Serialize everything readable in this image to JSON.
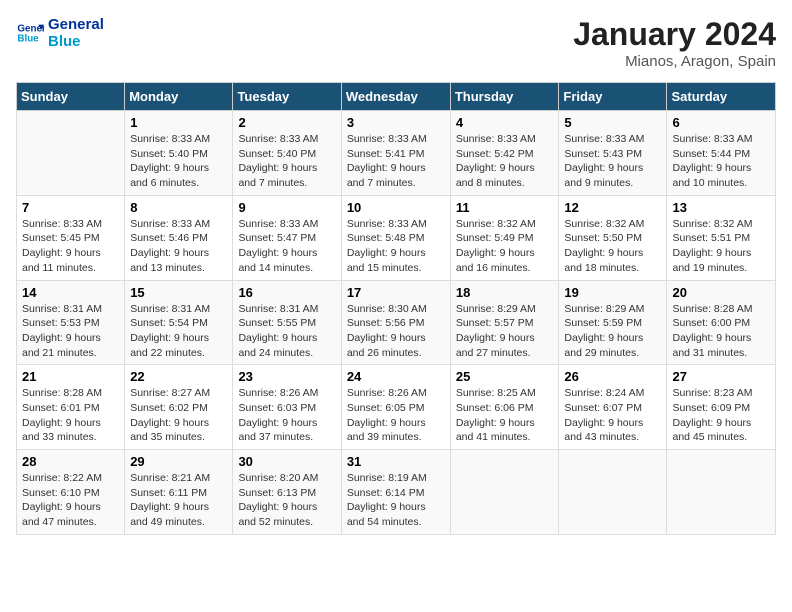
{
  "logo": {
    "line1": "General",
    "line2": "Blue"
  },
  "title": "January 2024",
  "location": "Mianos, Aragon, Spain",
  "days_of_week": [
    "Sunday",
    "Monday",
    "Tuesday",
    "Wednesday",
    "Thursday",
    "Friday",
    "Saturday"
  ],
  "weeks": [
    [
      {
        "num": "",
        "info": ""
      },
      {
        "num": "1",
        "info": "Sunrise: 8:33 AM\nSunset: 5:40 PM\nDaylight: 9 hours\nand 6 minutes."
      },
      {
        "num": "2",
        "info": "Sunrise: 8:33 AM\nSunset: 5:40 PM\nDaylight: 9 hours\nand 7 minutes."
      },
      {
        "num": "3",
        "info": "Sunrise: 8:33 AM\nSunset: 5:41 PM\nDaylight: 9 hours\nand 7 minutes."
      },
      {
        "num": "4",
        "info": "Sunrise: 8:33 AM\nSunset: 5:42 PM\nDaylight: 9 hours\nand 8 minutes."
      },
      {
        "num": "5",
        "info": "Sunrise: 8:33 AM\nSunset: 5:43 PM\nDaylight: 9 hours\nand 9 minutes."
      },
      {
        "num": "6",
        "info": "Sunrise: 8:33 AM\nSunset: 5:44 PM\nDaylight: 9 hours\nand 10 minutes."
      }
    ],
    [
      {
        "num": "7",
        "info": "Sunrise: 8:33 AM\nSunset: 5:45 PM\nDaylight: 9 hours\nand 11 minutes."
      },
      {
        "num": "8",
        "info": "Sunrise: 8:33 AM\nSunset: 5:46 PM\nDaylight: 9 hours\nand 13 minutes."
      },
      {
        "num": "9",
        "info": "Sunrise: 8:33 AM\nSunset: 5:47 PM\nDaylight: 9 hours\nand 14 minutes."
      },
      {
        "num": "10",
        "info": "Sunrise: 8:33 AM\nSunset: 5:48 PM\nDaylight: 9 hours\nand 15 minutes."
      },
      {
        "num": "11",
        "info": "Sunrise: 8:32 AM\nSunset: 5:49 PM\nDaylight: 9 hours\nand 16 minutes."
      },
      {
        "num": "12",
        "info": "Sunrise: 8:32 AM\nSunset: 5:50 PM\nDaylight: 9 hours\nand 18 minutes."
      },
      {
        "num": "13",
        "info": "Sunrise: 8:32 AM\nSunset: 5:51 PM\nDaylight: 9 hours\nand 19 minutes."
      }
    ],
    [
      {
        "num": "14",
        "info": "Sunrise: 8:31 AM\nSunset: 5:53 PM\nDaylight: 9 hours\nand 21 minutes."
      },
      {
        "num": "15",
        "info": "Sunrise: 8:31 AM\nSunset: 5:54 PM\nDaylight: 9 hours\nand 22 minutes."
      },
      {
        "num": "16",
        "info": "Sunrise: 8:31 AM\nSunset: 5:55 PM\nDaylight: 9 hours\nand 24 minutes."
      },
      {
        "num": "17",
        "info": "Sunrise: 8:30 AM\nSunset: 5:56 PM\nDaylight: 9 hours\nand 26 minutes."
      },
      {
        "num": "18",
        "info": "Sunrise: 8:29 AM\nSunset: 5:57 PM\nDaylight: 9 hours\nand 27 minutes."
      },
      {
        "num": "19",
        "info": "Sunrise: 8:29 AM\nSunset: 5:59 PM\nDaylight: 9 hours\nand 29 minutes."
      },
      {
        "num": "20",
        "info": "Sunrise: 8:28 AM\nSunset: 6:00 PM\nDaylight: 9 hours\nand 31 minutes."
      }
    ],
    [
      {
        "num": "21",
        "info": "Sunrise: 8:28 AM\nSunset: 6:01 PM\nDaylight: 9 hours\nand 33 minutes."
      },
      {
        "num": "22",
        "info": "Sunrise: 8:27 AM\nSunset: 6:02 PM\nDaylight: 9 hours\nand 35 minutes."
      },
      {
        "num": "23",
        "info": "Sunrise: 8:26 AM\nSunset: 6:03 PM\nDaylight: 9 hours\nand 37 minutes."
      },
      {
        "num": "24",
        "info": "Sunrise: 8:26 AM\nSunset: 6:05 PM\nDaylight: 9 hours\nand 39 minutes."
      },
      {
        "num": "25",
        "info": "Sunrise: 8:25 AM\nSunset: 6:06 PM\nDaylight: 9 hours\nand 41 minutes."
      },
      {
        "num": "26",
        "info": "Sunrise: 8:24 AM\nSunset: 6:07 PM\nDaylight: 9 hours\nand 43 minutes."
      },
      {
        "num": "27",
        "info": "Sunrise: 8:23 AM\nSunset: 6:09 PM\nDaylight: 9 hours\nand 45 minutes."
      }
    ],
    [
      {
        "num": "28",
        "info": "Sunrise: 8:22 AM\nSunset: 6:10 PM\nDaylight: 9 hours\nand 47 minutes."
      },
      {
        "num": "29",
        "info": "Sunrise: 8:21 AM\nSunset: 6:11 PM\nDaylight: 9 hours\nand 49 minutes."
      },
      {
        "num": "30",
        "info": "Sunrise: 8:20 AM\nSunset: 6:13 PM\nDaylight: 9 hours\nand 52 minutes."
      },
      {
        "num": "31",
        "info": "Sunrise: 8:19 AM\nSunset: 6:14 PM\nDaylight: 9 hours\nand 54 minutes."
      },
      {
        "num": "",
        "info": ""
      },
      {
        "num": "",
        "info": ""
      },
      {
        "num": "",
        "info": ""
      }
    ]
  ]
}
